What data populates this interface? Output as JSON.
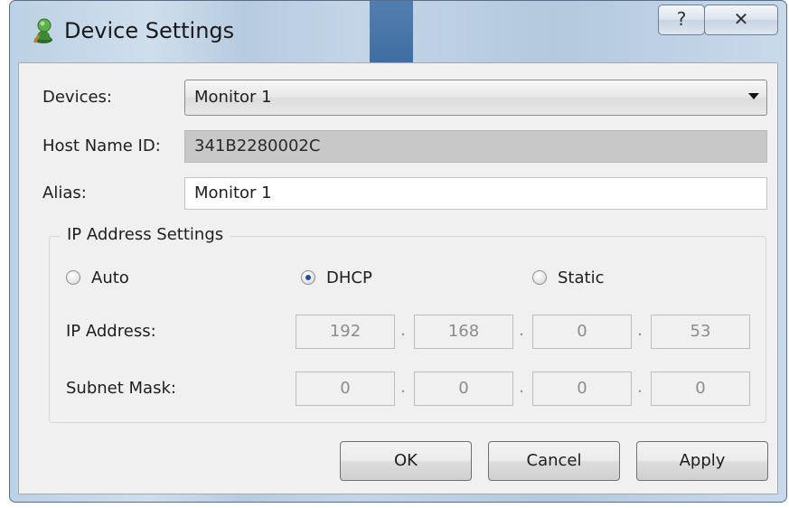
{
  "window": {
    "title": "Device Settings",
    "help_label": "?",
    "close_label": "✕"
  },
  "form": {
    "devices_label": "Devices:",
    "devices_value": "Monitor 1",
    "host_label": "Host Name ID:",
    "host_value": "341B2280002C",
    "alias_label": "Alias:",
    "alias_value": "Monitor 1"
  },
  "ip_settings": {
    "legend": "IP Address Settings",
    "modes": [
      {
        "label": "Auto",
        "selected": false
      },
      {
        "label": "DHCP",
        "selected": true
      },
      {
        "label": "Static",
        "selected": false
      }
    ],
    "ip_label": "IP Address:",
    "ip_octets": [
      "192",
      "168",
      "0",
      "53"
    ],
    "subnet_label": "Subnet Mask:",
    "subnet_octets": [
      "0",
      "0",
      "0",
      "0"
    ],
    "separator": "."
  },
  "buttons": {
    "ok": "OK",
    "cancel": "Cancel",
    "apply": "Apply"
  }
}
